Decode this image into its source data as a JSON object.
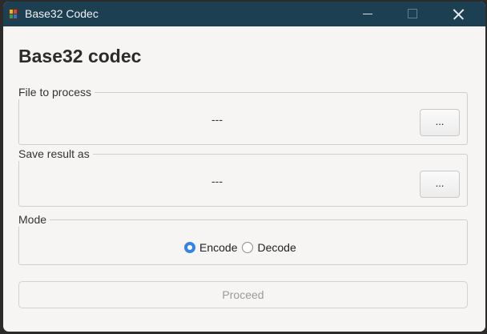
{
  "window": {
    "title": "Base32 Codec"
  },
  "heading": "Base32 codec",
  "file_group": {
    "label": "File to process",
    "value": "---",
    "browse_label": "..."
  },
  "save_group": {
    "label": "Save result as",
    "value": "---",
    "browse_label": "..."
  },
  "mode_group": {
    "label": "Mode",
    "options": [
      {
        "label": "Encode",
        "selected": true
      },
      {
        "label": "Decode",
        "selected": false
      }
    ]
  },
  "proceed_label": "Proceed",
  "proceed_enabled": false,
  "colors": {
    "titlebar": "#1d3f52",
    "accent": "#3584e4",
    "window_bg": "#f6f5f4"
  }
}
